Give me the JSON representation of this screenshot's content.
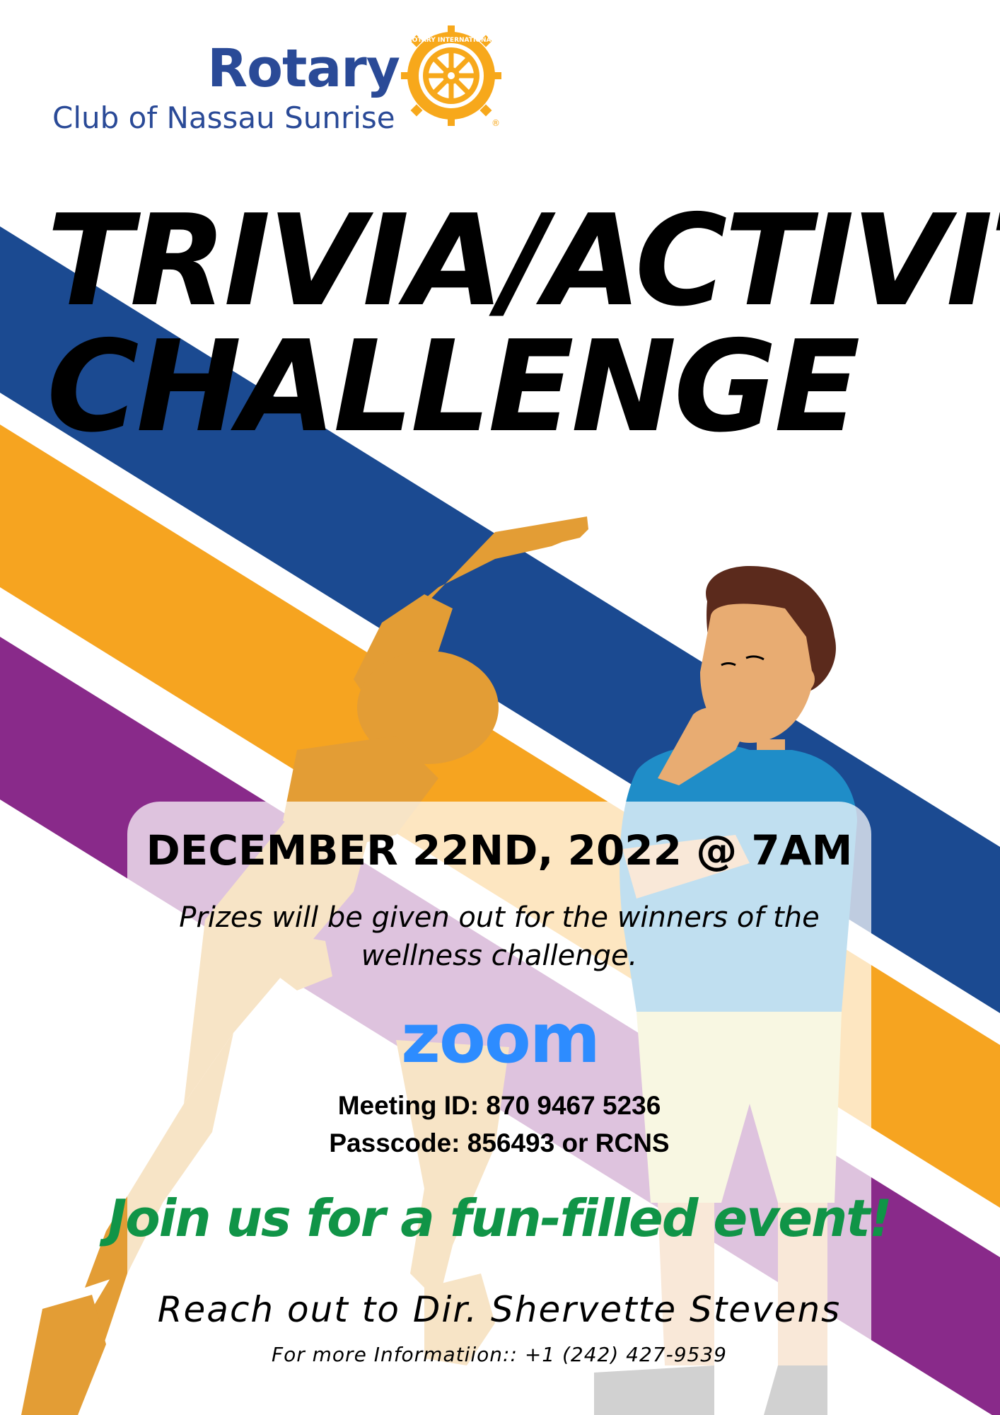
{
  "logo": {
    "wordmark": "Rotary",
    "club": "Club of Nassau Sunrise",
    "seal_text": "ROTARY INTERNATIONAL",
    "registered": "®",
    "brand_blue": "#2a4a97",
    "brand_gold": "#f7a81b"
  },
  "title": {
    "line1": "TRIVIA/ACTIVITY",
    "line2": "CHALLENGE"
  },
  "event": {
    "date": "DECEMBER 22ND, 2022 @ 7AM",
    "prizes": "Prizes will be given out for the winners of the wellness challenge.",
    "platform": "zoom",
    "meeting_id": "Meeting ID: 870 9467 5236",
    "passcode": "Passcode: 856493 or RCNS"
  },
  "cta": {
    "join": "Join us for a fun-filled event!",
    "contact": "Reach out to Dir. Shervette Stevens",
    "info": "For more Informatiion:: +1 (242) 427-9539"
  },
  "colors": {
    "stripe_blue": "#1b4a91",
    "stripe_orange": "#f6a420",
    "stripe_purple": "#892a8a",
    "join_green": "#109447",
    "zoom_blue": "#2d8cff"
  },
  "illustrations": [
    "stretching-woman",
    "thinking-boy"
  ]
}
